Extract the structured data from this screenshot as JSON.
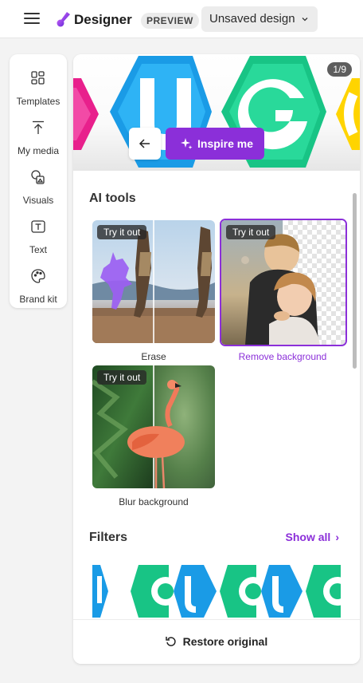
{
  "app": {
    "brand": "Designer",
    "badge": "PREVIEW",
    "design_name": "Unsaved design"
  },
  "sidebar": {
    "items": [
      {
        "label": "Templates",
        "icon": "templates-icon"
      },
      {
        "label": "My media",
        "icon": "upload-icon"
      },
      {
        "label": "Visuals",
        "icon": "shapes-icon"
      },
      {
        "label": "Text",
        "icon": "text-icon"
      },
      {
        "label": "Brand kit",
        "icon": "palette-icon"
      }
    ]
  },
  "canvas": {
    "pager": "1/9",
    "inspire_label": "Inspire me"
  },
  "ai_tools": {
    "title": "AI tools",
    "try_label": "Try it out",
    "items": [
      {
        "label": "Erase",
        "selected": false
      },
      {
        "label": "Remove background",
        "selected": true
      },
      {
        "label": "Blur background",
        "selected": false
      }
    ]
  },
  "filters": {
    "title": "Filters",
    "show_all": "Show all"
  },
  "footer": {
    "restore_label": "Restore original"
  },
  "colors": {
    "accent": "#8b2fd9",
    "hex_blue": "#1a9be6",
    "hex_green": "#1fcf8a",
    "hex_pink": "#e8208c",
    "hex_yellow": "#ffd400"
  }
}
